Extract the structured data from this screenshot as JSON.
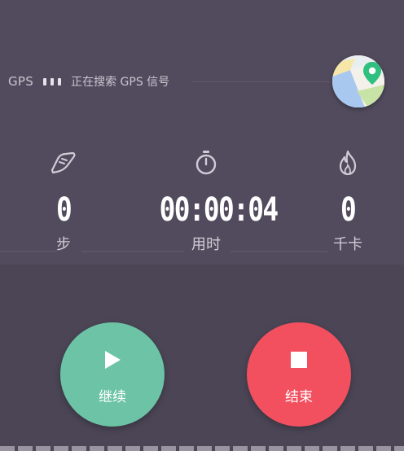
{
  "gps": {
    "label": "GPS",
    "status": "正在搜索 GPS 信号"
  },
  "map_button": {
    "icon": "map-pin-icon"
  },
  "stats": [
    {
      "icon": "shoe-icon",
      "value": "0",
      "label": "步"
    },
    {
      "icon": "stopwatch-icon",
      "value": "00:00:04",
      "label": "用时"
    },
    {
      "icon": "flame-icon",
      "value": "0",
      "label": "千卡"
    }
  ],
  "controls": {
    "resume": {
      "icon": "play-icon",
      "label": "继续",
      "color": "#6cc3a5"
    },
    "stop": {
      "icon": "stop-icon",
      "label": "结束",
      "color": "#f2505f"
    }
  },
  "colors": {
    "background": "#4e4858",
    "accent_green": "#6cc3a5",
    "accent_red": "#f2505f"
  }
}
